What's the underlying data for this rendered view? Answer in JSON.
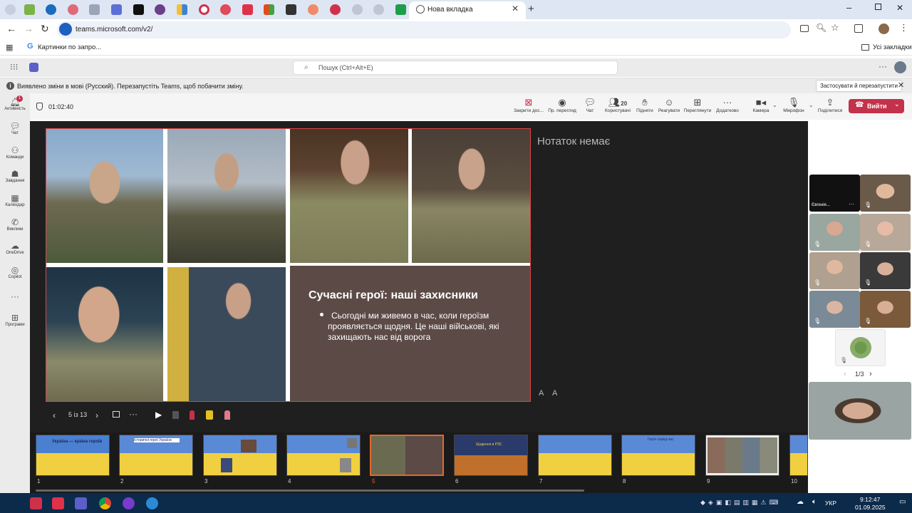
{
  "browser": {
    "active_tab_title": "Нова вкладка",
    "url": "teams.microsoft.com/v2/",
    "bookmark": "Картинки по запро...",
    "all_bookmarks": "Усі закладки"
  },
  "teams": {
    "search_placeholder": "Пошук (Ctrl+Alt+E)",
    "notice_text": "Виявлено зміни в мові (Русский). Перезапустіть Teams, щоб побачити зміну.",
    "restart_button": "Застосувати й перезапустити",
    "rail": [
      {
        "label": "Активність",
        "icon": "bell-icon",
        "badge": "1"
      },
      {
        "label": "Чат",
        "icon": "chat-icon"
      },
      {
        "label": "Команди",
        "icon": "teams-icon"
      },
      {
        "label": "Завдання",
        "icon": "assignments-icon"
      },
      {
        "label": "Календар",
        "icon": "calendar-icon"
      },
      {
        "label": "Виклики",
        "icon": "calls-icon"
      },
      {
        "label": "OneDrive",
        "icon": "cloud-icon"
      },
      {
        "label": "Copilot",
        "icon": "copilot-icon"
      },
      {
        "label": "Програми",
        "icon": "apps-icon"
      }
    ],
    "meeting": {
      "timer": "01:02:40",
      "tools": [
        {
          "label": "Закрити дос...",
          "icon": "close-share-icon"
        },
        {
          "label": "Пр. перегляд",
          "icon": "eye-icon"
        },
        {
          "label": "Чат",
          "icon": "chat-icon"
        },
        {
          "label": "Користувачі",
          "icon": "people-icon",
          "count": "20"
        },
        {
          "label": "Підняти",
          "icon": "hand-icon"
        },
        {
          "label": "Реагувати",
          "icon": "smile-icon"
        },
        {
          "label": "Переглянути",
          "icon": "view-icon"
        },
        {
          "label": "Додатково",
          "icon": "more-icon"
        },
        {
          "label": "Камера",
          "icon": "camera-icon"
        },
        {
          "label": "Мікрофон",
          "icon": "mic-icon"
        },
        {
          "label": "Поділитися",
          "icon": "share-icon"
        }
      ],
      "leave_button": "Вийти"
    },
    "slide": {
      "title": "Сучасні герої: наші захисники",
      "bullet": "Сьогодні ми живемо в час, коли героїзм проявляється щодня. Це наші військові, які захищають нас від ворога"
    },
    "notes_text": "Нотаток немає",
    "font_controls": [
      "A",
      "A"
    ],
    "slide_counter": "5 із 13",
    "thumbnails": [
      {
        "num": "1",
        "title": "Україна — країна героїв"
      },
      {
        "num": "2",
        "title": "Історичні герої України"
      },
      {
        "num": "3",
        "title": ""
      },
      {
        "num": "4",
        "title": ""
      },
      {
        "num": "5",
        "title": ""
      },
      {
        "num": "6",
        "title": "Щодення в РЗС"
      },
      {
        "num": "7",
        "title": ""
      },
      {
        "num": "8",
        "title": "Герої серед нас"
      },
      {
        "num": "9",
        "title": ""
      },
      {
        "num": "10",
        "title": ""
      }
    ],
    "participants": {
      "first_name": "Євгенія...",
      "pager": "1/3"
    }
  },
  "taskbar": {
    "lang": "УКР",
    "time": "9:12:47",
    "date": "01.09.2025"
  },
  "colors": {
    "leave": "#c4314b",
    "accent": "#5b5fc7",
    "slide_text_bg": "#5b4a46"
  }
}
